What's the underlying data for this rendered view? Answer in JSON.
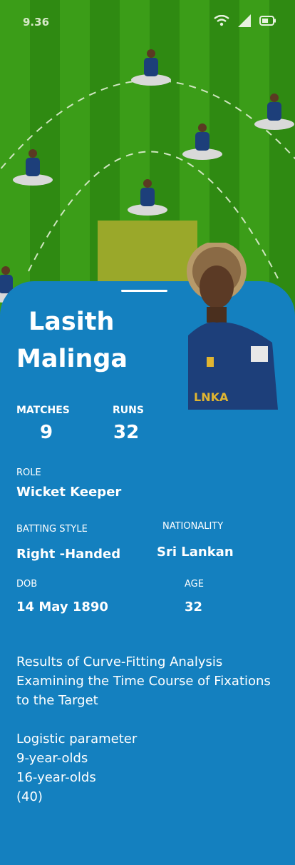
{
  "status_bar": {
    "time": "9.36",
    "icons": [
      "wifi-icon",
      "signal-icon",
      "battery-icon"
    ]
  },
  "field": {
    "players": [
      "player-icon",
      "player-icon",
      "player-icon",
      "player-icon",
      "player-icon",
      "player-icon",
      "player-icon"
    ]
  },
  "player": {
    "first_name": "Lasith",
    "last_name": "Malinga",
    "matches_label": "MATCHES",
    "matches": "9",
    "runs_label": "RUNS",
    "runs": "32",
    "role_label": "ROLE",
    "role": "Wicket Keeper",
    "batting_style_label": "BATTING STYLE",
    "batting_style": "Right -Handed",
    "nationality_label": "NATIONALITY",
    "nationality": "Sri Lankan",
    "dob_label": "DOB",
    "dob": "14 May 1890",
    "age_label": "AGE",
    "age": "32"
  },
  "description": {
    "line1": "Results of Curve-Fitting Analysis",
    "line2": "Examining the Time Course of Fixations",
    "line3": "to the Target",
    "line4": "Logistic parameter",
    "line5": "9-year-olds",
    "line6": "16-year-olds",
    "line7": "(40)"
  },
  "colors": {
    "card": "#1480bf",
    "field_dark": "#2f8a12",
    "field_light": "#3b9d18",
    "pitch": "#9aa82a",
    "jersey": "#1d3f7a"
  }
}
